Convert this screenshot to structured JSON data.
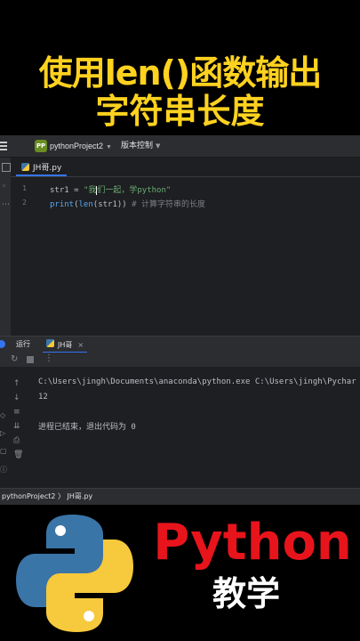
{
  "overlay": {
    "title_line1": "使用len()函数输出",
    "title_line2": "字符串长度"
  },
  "topbar": {
    "project_badge": "PP",
    "project_name": "pythonProject2",
    "vcs_label": "版本控制"
  },
  "editor": {
    "tab_label": "JH哥.py",
    "lines": [
      {
        "number": "1",
        "var": "str1",
        "op": " = ",
        "str_before": "\"我",
        "str_after": "们一起，学python\""
      },
      {
        "number": "2",
        "func1": "print",
        "p1": "(",
        "func2": "len",
        "p2": "(",
        "arg": "str1",
        "close": "))",
        "comment": " # 计算字符串的长度"
      }
    ]
  },
  "run_panel": {
    "run_label": "运行",
    "tab_label": "JH哥",
    "close_glyph": "×",
    "output": [
      "C:\\Users\\jingh\\Documents\\anaconda\\python.exe C:\\Users\\jingh\\Pychar",
      "12",
      "",
      "进程已结束，退出代码为 0"
    ]
  },
  "statusbar": {
    "breadcrumb": "pythonProject2 〉 JH哥.py"
  },
  "brand": {
    "python_text": "Python",
    "subtitle": "教学"
  },
  "colors": {
    "title_yellow": "#ffd21f",
    "python_red": "#e8141c",
    "python_blue": "#3a75a8",
    "python_yellow": "#f7c93c",
    "ide_bg": "#1e1f22",
    "string_green": "#6aab73",
    "func_blue": "#56a8f5",
    "comment_gray": "#7a7e85"
  }
}
